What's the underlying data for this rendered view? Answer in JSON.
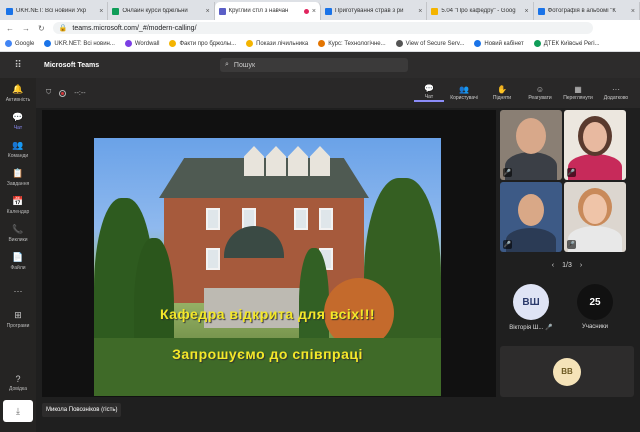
{
  "browser": {
    "tabs": [
      {
        "title": "UKR.NET: Всі новини Укр",
        "color": "#1a73e8"
      },
      {
        "title": "Онлайн курси бджільни",
        "color": "#0f9d58"
      },
      {
        "title": "Круглий стіл з навчан",
        "color": "#5b5fc7",
        "active": true
      },
      {
        "title": "Приготування страв з ри",
        "color": "#1a73e8"
      },
      {
        "title": "5.04 \"Про кафедру\" - Goog",
        "color": "#f4b400"
      },
      {
        "title": "Фотографія в альбомі \"К",
        "color": "#1a73e8"
      }
    ],
    "url": "teams.microsoft.com/_#/modern-calling/",
    "bookmarks": [
      {
        "label": "Google",
        "color": "#4285f4"
      },
      {
        "label": "UKR.NET: Всі новин...",
        "color": "#1a73e8"
      },
      {
        "label": "Wordwall",
        "color": "#7b3fe4"
      },
      {
        "label": "Факти про бджолы...",
        "color": "#f4b400"
      },
      {
        "label": "Покази лічильника",
        "color": "#f4b400"
      },
      {
        "label": "Курс: Технологічне...",
        "color": "#e37400"
      },
      {
        "label": "View of Secure Serv...",
        "color": "#555555"
      },
      {
        "label": "Новий кабінет",
        "color": "#1a73e8"
      },
      {
        "label": "ДТЕК Київські Регі...",
        "color": "#0f9d58"
      }
    ]
  },
  "teams": {
    "app_name": "Microsoft Teams",
    "search_placeholder": "Пошук",
    "rail": [
      {
        "icon": "bell-icon",
        "glyph": "🔔",
        "label": "Активність"
      },
      {
        "icon": "chat-icon",
        "glyph": "💬",
        "label": "Чат",
        "active": true
      },
      {
        "icon": "teams-icon",
        "glyph": "👥",
        "label": "Команди"
      },
      {
        "icon": "assignments-icon",
        "glyph": "📋",
        "label": "Завдання"
      },
      {
        "icon": "calendar-icon",
        "glyph": "📅",
        "label": "Календар"
      },
      {
        "icon": "calls-icon",
        "glyph": "📞",
        "label": "Виклики"
      },
      {
        "icon": "files-icon",
        "glyph": "📄",
        "label": "Файли"
      },
      {
        "icon": "more-icon",
        "glyph": "···",
        "label": ""
      },
      {
        "icon": "apps-icon",
        "glyph": "⊞",
        "label": "Програми"
      },
      {
        "icon": "help-icon",
        "glyph": "?",
        "label": "Довідка"
      }
    ]
  },
  "meeting": {
    "timer": "--:--",
    "controls": [
      {
        "icon": "chat-icon",
        "glyph": "💬",
        "label": "Чат",
        "active": true
      },
      {
        "icon": "people-icon",
        "glyph": "👥",
        "label": "Користувачі"
      },
      {
        "icon": "raise-hand-icon",
        "glyph": "✋",
        "label": "Підняти"
      },
      {
        "icon": "react-icon",
        "glyph": "☺",
        "label": "Реагувати"
      },
      {
        "icon": "view-icon",
        "glyph": "▦",
        "label": "Переглянути"
      },
      {
        "icon": "more-options-icon",
        "glyph": "···",
        "label": "Додатково"
      }
    ],
    "share": {
      "caption_line1": "Кафедра відкрита для всіх!!!",
      "caption_line2": "Запрошуємо до співпраці"
    },
    "presenter_name": "Микола Повозніков (гість)",
    "pager": "1/3",
    "avatars": [
      {
        "initials": "ВШ",
        "label": "Вікторія Ш...",
        "bg": "#dfe4f5",
        "fg": "#2b3a6b"
      },
      {
        "initials": "25",
        "label": "Учасники",
        "bg": "#111111",
        "fg": "#ffffff"
      }
    ],
    "self_initials": "ВВ"
  }
}
